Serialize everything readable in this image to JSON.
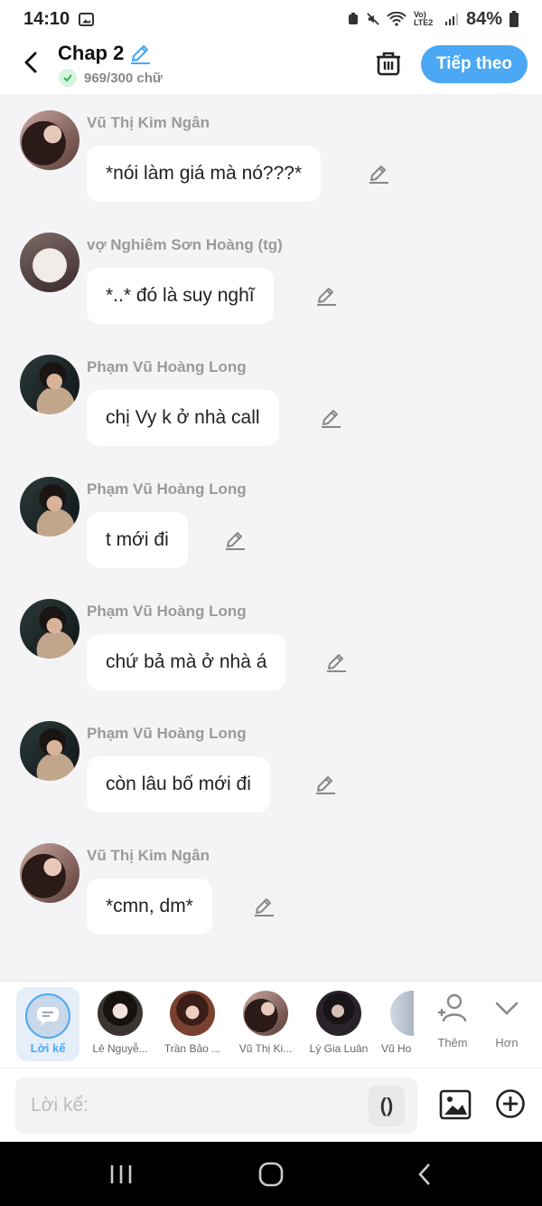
{
  "status_bar": {
    "time": "14:10",
    "network_label": "Vo) LTE2",
    "battery": "84%"
  },
  "header": {
    "title": "Chap 2",
    "word_count": "969/300 chữ",
    "next_button": "Tiếp theo"
  },
  "messages": [
    {
      "author": "Vũ Thị Kim Ngân",
      "text": "*nói làm giá mà nó???*",
      "avatar": "girl"
    },
    {
      "author": "vợ Nghiêm Sơn Hoàng  (tg)",
      "text": "*..* đó là suy nghĩ",
      "avatar": "meme"
    },
    {
      "author": "Phạm Vũ Hoàng Long",
      "text": "chị Vy k ở nhà call",
      "avatar": "boy"
    },
    {
      "author": "Phạm Vũ Hoàng Long",
      "text": "t mới đi",
      "avatar": "boy"
    },
    {
      "author": "Phạm Vũ Hoàng Long",
      "text": "chứ bả mà ở nhà á",
      "avatar": "boy"
    },
    {
      "author": "Phạm Vũ Hoàng Long",
      "text": "còn lâu bố mới đi",
      "avatar": "boy"
    },
    {
      "author": "Vũ Thị Kim Ngân",
      "text": "*cmn, dm*",
      "avatar": "girl"
    }
  ],
  "character_bar": {
    "narrator_label": "Lời kể",
    "characters": [
      {
        "name": "Lê Nguyễ..."
      },
      {
        "name": "Trần Bảo ..."
      },
      {
        "name": "Vũ Thị Ki..."
      },
      {
        "name": "Lý Gia Luân"
      },
      {
        "name": "Vũ Ho"
      }
    ],
    "add_label": "Thêm",
    "more_label": "Hơn"
  },
  "composer": {
    "placeholder": "Lời kể:",
    "paren_button": "()"
  },
  "colors": {
    "accent": "#4aa8f5",
    "background": "#f4f4f6",
    "bubble": "#ffffff",
    "author_text": "#9a9a9a"
  }
}
